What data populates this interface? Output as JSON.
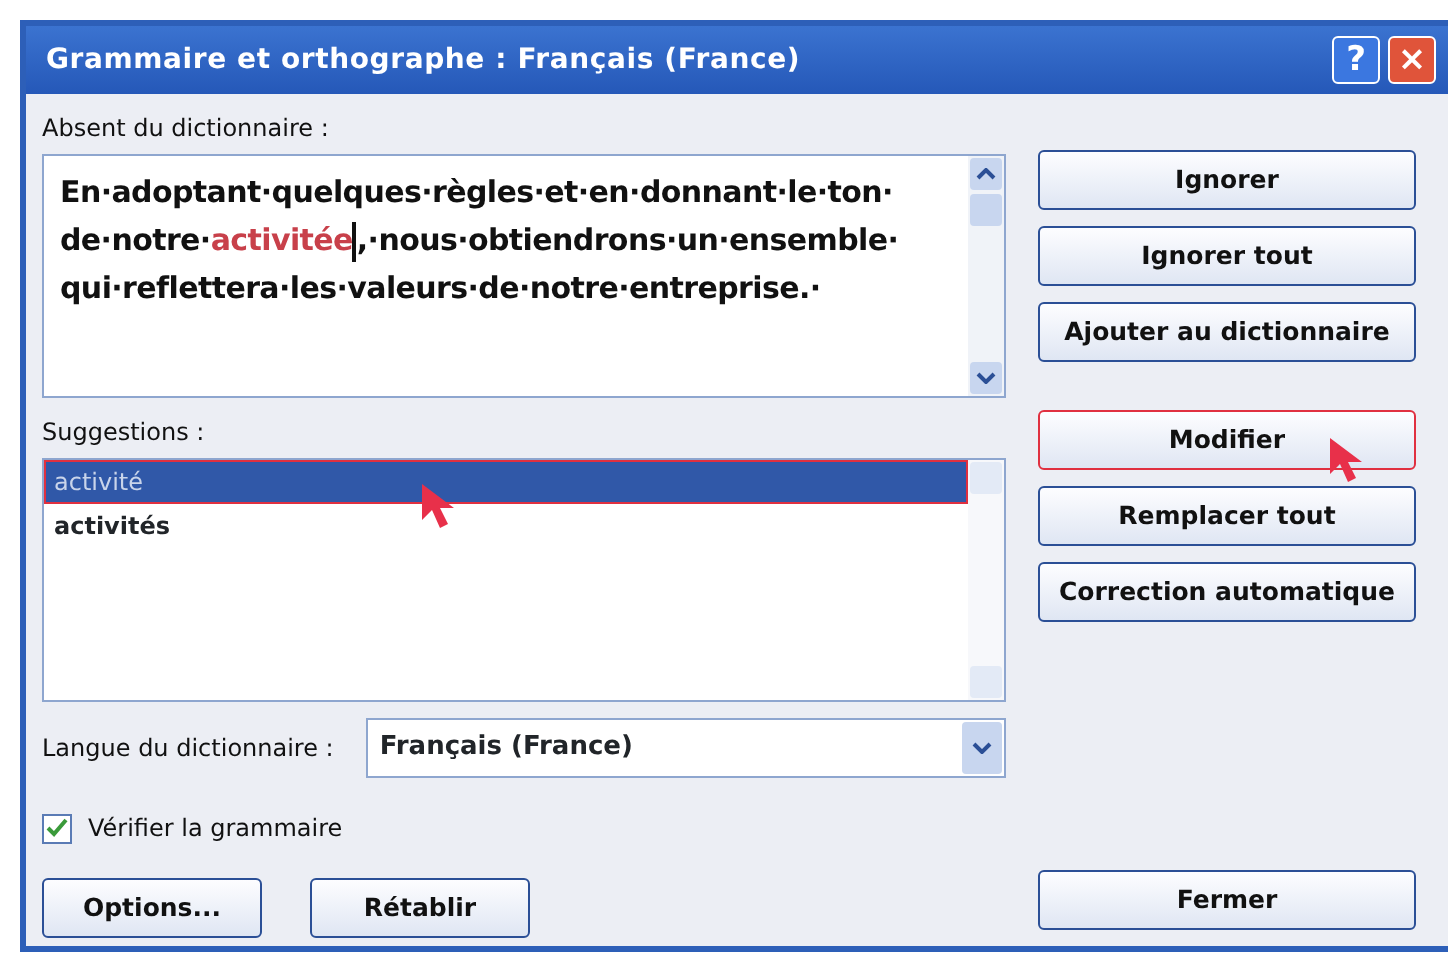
{
  "window": {
    "title": "Grammaire et orthographe : Français (France)",
    "help": "?",
    "close": "×"
  },
  "not_in_dictionary": {
    "label": "Absent du dictionnaire :",
    "lines": [
      [
        {
          "kind": "normal",
          "text": "En·adoptant·quelques·règles·et·en·donnant·le·ton·"
        }
      ],
      [
        {
          "kind": "normal",
          "text": "de·notre·"
        },
        {
          "kind": "error",
          "text": "activitée"
        },
        {
          "kind": "caret"
        },
        {
          "kind": "normal",
          "text": ",·nous·obtiendrons·un·ensemble·"
        }
      ],
      [
        {
          "kind": "normal",
          "text": "qui·reflettera·les·valeurs·de·notre·entreprise.·"
        }
      ]
    ]
  },
  "suggestions": {
    "label": "Suggestions :",
    "items": [
      {
        "text": "activité",
        "selected": true,
        "highlighted": true,
        "pointer": true
      },
      {
        "text": "activités",
        "selected": false,
        "highlighted": false,
        "pointer": false
      }
    ]
  },
  "language": {
    "label": "Langue du dictionnaire :",
    "value": "Français (France)"
  },
  "check_grammar": {
    "label": "Vérifier la grammaire",
    "checked": true
  },
  "side_button_groups": [
    [
      {
        "label": "Ignorer",
        "highlighted": false,
        "pointer": false
      },
      {
        "label": "Ignorer tout",
        "highlighted": false,
        "pointer": false
      },
      {
        "label": "Ajouter au dictionnaire",
        "highlighted": false,
        "pointer": false
      }
    ],
    [
      {
        "label": "Modifier",
        "highlighted": true,
        "pointer": true
      },
      {
        "label": "Remplacer tout",
        "highlighted": false,
        "pointer": false
      },
      {
        "label": "Correction automatique",
        "highlighted": false,
        "pointer": false
      }
    ]
  ],
  "bottom_left_buttons": [
    "Options...",
    "Rétablir"
  ],
  "bottom_right_buttons": [
    "Fermer"
  ]
}
